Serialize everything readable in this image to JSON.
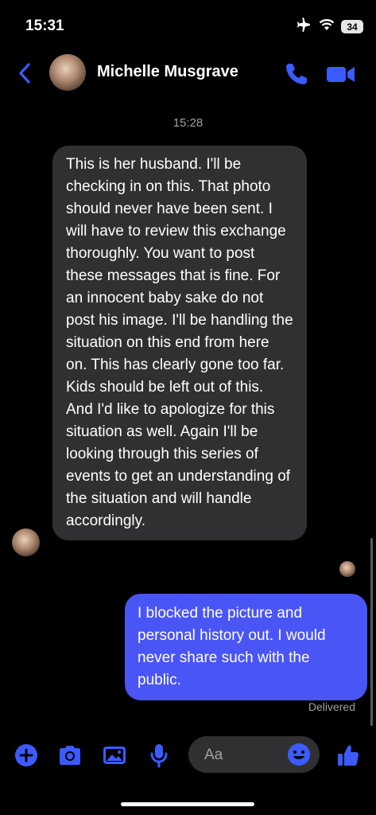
{
  "status_bar": {
    "time": "15:31",
    "battery": "34",
    "icons": [
      "airplane-icon",
      "wifi-icon",
      "battery-icon"
    ]
  },
  "header": {
    "contact_name": "Michelle Musgrave",
    "icons": [
      "back-chevron-icon",
      "phone-icon",
      "video-camera-icon"
    ]
  },
  "conversation": {
    "timestamp": "15:28",
    "incoming_message": "This is her husband. I'll be checking in on this. That photo should never have been sent. I will have to review this exchange thoroughly. You want to post these messages that is fine. For an innocent baby sake do not post his image. I'll be handling the situation on this end from here on. This has clearly gone too far. Kids should be left out of this. And I'd like to apologize for this situation as well. Again I'll be looking through this series of events to get an understanding of the situation and will handle accordingly.",
    "outgoing_message": "I blocked the picture and personal history out. I would never share such with the public.",
    "delivery_status": "Delivered"
  },
  "composer": {
    "placeholder": "Aa",
    "icons": [
      "plus-icon",
      "camera-icon",
      "image-icon",
      "microphone-icon",
      "emoji-icon",
      "thumbs-up-icon"
    ]
  },
  "colors": {
    "accent": "#3b5bff",
    "outgoing_bubble": "#4a55f5",
    "incoming_bubble": "#303033",
    "background": "#000000"
  }
}
